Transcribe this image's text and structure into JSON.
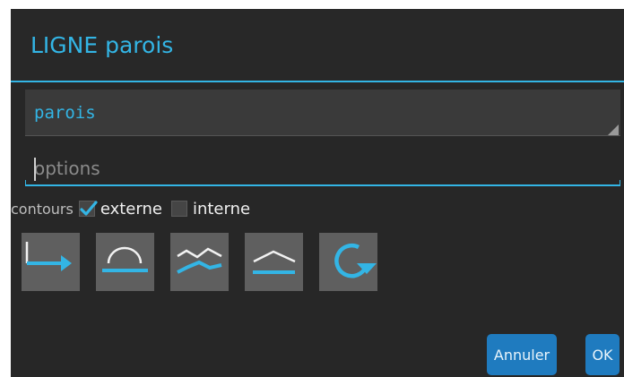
{
  "dialog": {
    "title": "LIGNE parois"
  },
  "name_field": {
    "value": "parois"
  },
  "options_field": {
    "placeholder": "options"
  },
  "contours": {
    "label": "contours",
    "externe": {
      "label": "externe",
      "checked": true
    },
    "interne": {
      "label": "interne",
      "checked": false
    }
  },
  "tools": [
    {
      "icon": "line-arrow-icon"
    },
    {
      "icon": "arc-over-line-icon"
    },
    {
      "icon": "zigzag-lines-icon"
    },
    {
      "icon": "chevron-over-line-icon"
    },
    {
      "icon": "rotate-arrow-icon"
    }
  ],
  "buttons": {
    "cancel_label": "Annuler",
    "ok_label": "OK"
  },
  "colors": {
    "accent": "#33b5e5",
    "dialog_bg": "#272727",
    "button_bg": "#1f7bbf",
    "tool_bg": "#5f5f5f"
  }
}
